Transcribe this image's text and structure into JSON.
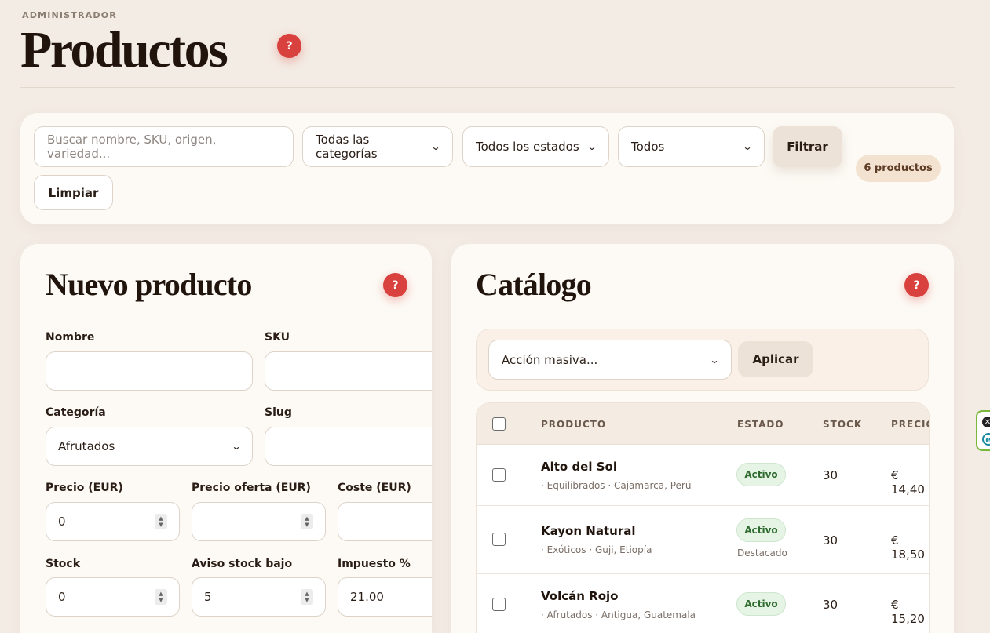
{
  "header": {
    "eyebrow": "ADMINISTRADOR",
    "title": "Productos",
    "help": "?"
  },
  "filters": {
    "search_placeholder": "Buscar nombre, SKU, origen, variedad...",
    "category_select": "Todas las categorías",
    "status_select": "Todos los estados",
    "featured_select": "Todos",
    "filter_button": "Filtrar",
    "clear_button": "Limpiar",
    "count_badge": "6 productos"
  },
  "new_product": {
    "title": "Nuevo producto",
    "help": "?",
    "fields": {
      "nombre_label": "Nombre",
      "nombre_value": "",
      "sku_label": "SKU",
      "sku_value": "",
      "categoria_label": "Categoría",
      "categoria_value": "Afrutados",
      "slug_label": "Slug",
      "slug_value": "",
      "precio_label": "Precio (EUR)",
      "precio_value": "0",
      "precio_oferta_label": "Precio oferta (EUR)",
      "precio_oferta_value": "",
      "coste_label": "Coste (EUR)",
      "coste_value": "",
      "stock_label": "Stock",
      "stock_value": "0",
      "aviso_label": "Aviso stock bajo",
      "aviso_value": "5",
      "impuesto_label": "Impuesto %",
      "impuesto_value": "21.00"
    }
  },
  "catalog": {
    "title": "Catálogo",
    "help": "?",
    "bulk_select": "Acción masiva...",
    "apply_button": "Aplicar",
    "columns": [
      "PRODUCTO",
      "ESTADO",
      "STOCK",
      "PRECIO"
    ],
    "rows": [
      {
        "name": "Alto del Sol",
        "meta": "· Equilibrados · Cajamarca, Perú",
        "status": "Activo",
        "note": "",
        "stock": "30",
        "price": "€ 14,40"
      },
      {
        "name": "Kayon Natural",
        "meta": "· Exóticos · Guji, Etiopía",
        "status": "Activo",
        "note": "Destacado",
        "stock": "30",
        "price": "€ 18,50"
      },
      {
        "name": "Volcán Rojo",
        "meta": "· Afrutados · Antigua, Guatemala",
        "status": "Activo",
        "note": "",
        "stock": "30",
        "price": "€ 15,20"
      }
    ]
  },
  "extension": {
    "close_glyph": "✕",
    "logo_glyph": "e"
  }
}
